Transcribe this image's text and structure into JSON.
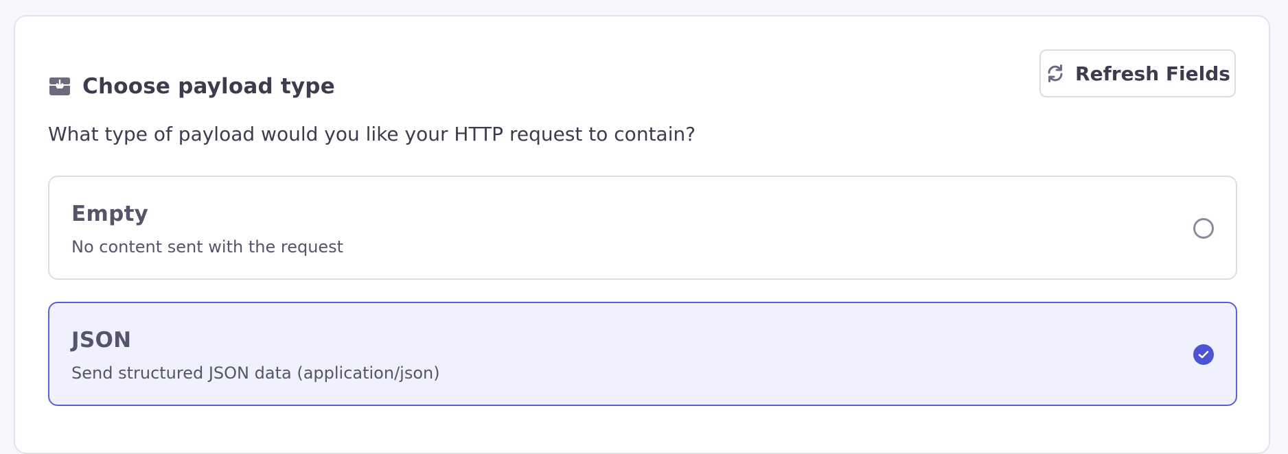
{
  "section": {
    "title": "Choose payload type",
    "icon": "inbox-download-icon",
    "question": "What type of payload would you like your HTTP request to contain?"
  },
  "refresh": {
    "label": "Refresh Fields",
    "icon": "refresh-icon"
  },
  "options": [
    {
      "title": "Empty",
      "description": "No content sent with the request",
      "selected": false
    },
    {
      "title": "JSON",
      "description": "Send structured JSON data (application/json)",
      "selected": true
    }
  ],
  "colors": {
    "accent": "#4d52d6",
    "selected_bg": "#f0f1fd",
    "text": "#3d3c4f"
  }
}
